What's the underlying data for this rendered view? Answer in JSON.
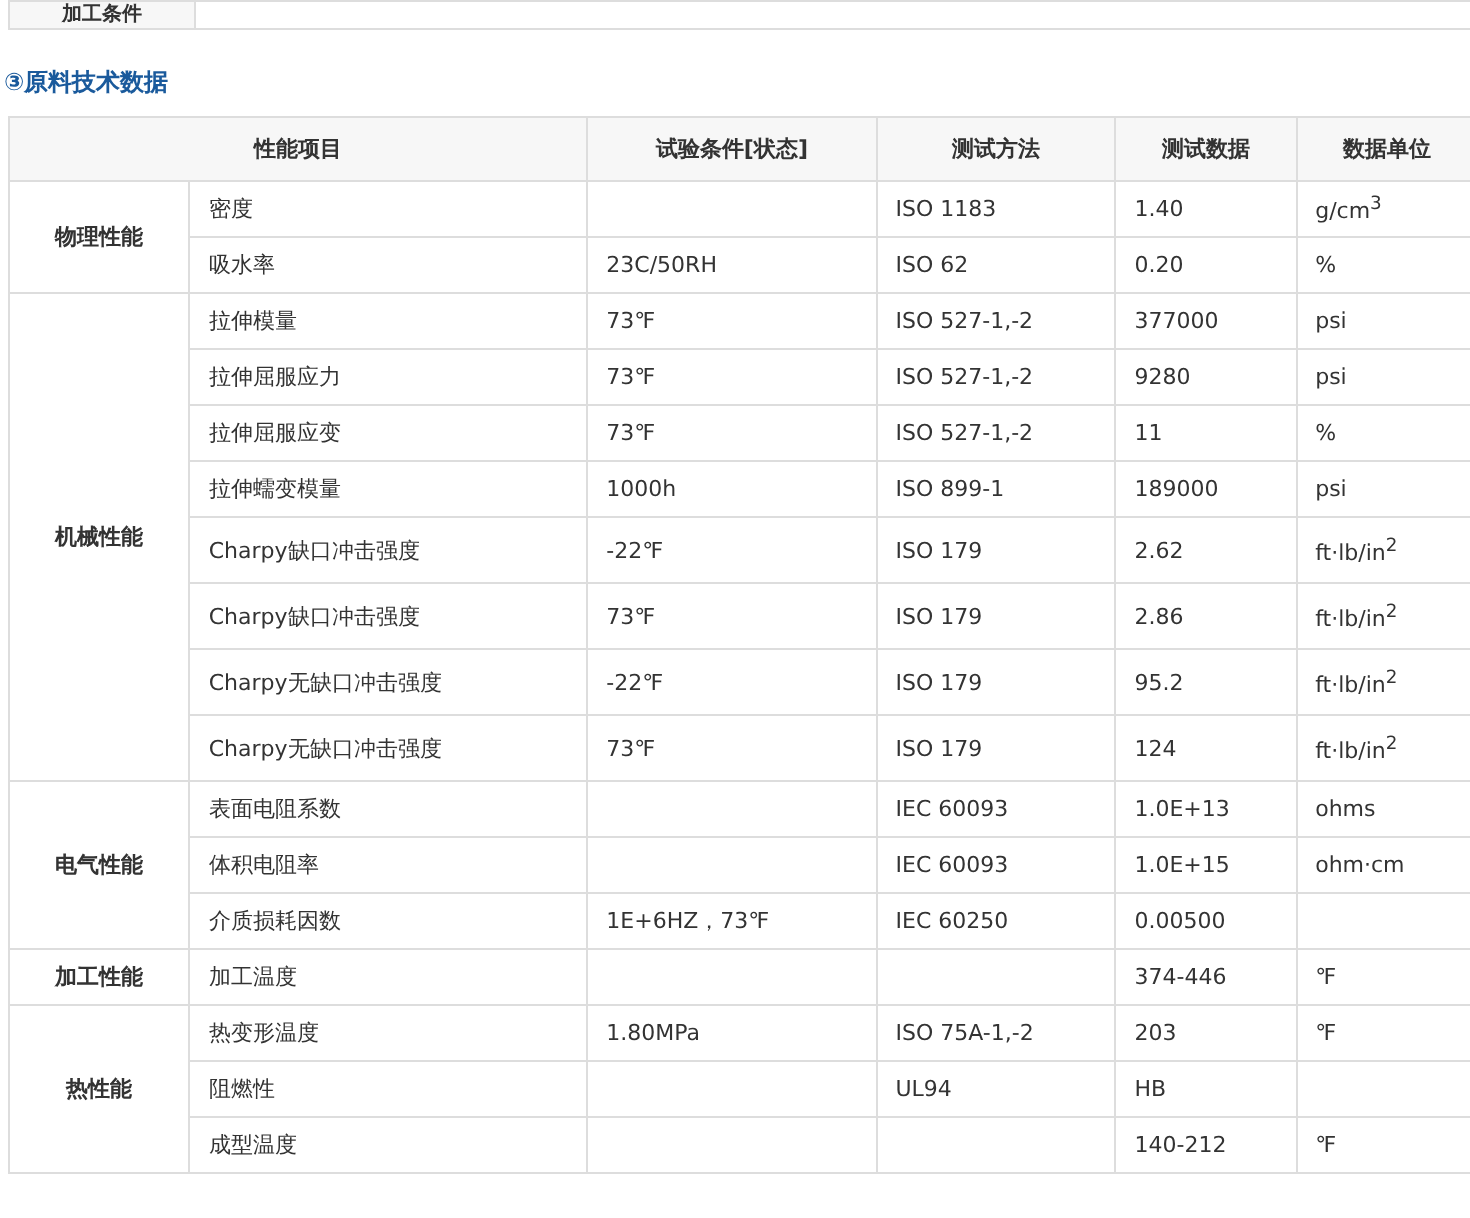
{
  "previous_table": {
    "label": "加工条件"
  },
  "section_title": "③原料技术数据",
  "table": {
    "columns": [
      "性能项目",
      "试验条件[状态]",
      "测试方法",
      "测试数据",
      "数据单位"
    ],
    "groups": [
      {
        "name": "物理性能",
        "rows": [
          {
            "item": "密度",
            "method": "ISO 1183",
            "value": "1.40",
            "unit": "g/cm$^{3}$"
          },
          {
            "item": "吸水率",
            "condition": "23C/50RH",
            "method": "ISO 62",
            "value": "0.20",
            "unit": "%"
          }
        ]
      },
      {
        "name": "机械性能",
        "rows": [
          {
            "item": "拉伸模量",
            "condition": "73℉",
            "method": "ISO 527-1,-2",
            "value": "377000",
            "unit": "psi"
          },
          {
            "item": "拉伸屈服应力",
            "condition": "73℉",
            "method": "ISO 527-1,-2",
            "value": "9280",
            "unit": "psi"
          },
          {
            "item": "拉伸屈服应变",
            "condition": "73℉",
            "method": "ISO 527-1,-2",
            "value": "11",
            "unit": "%"
          },
          {
            "item": "拉伸蠕变模量",
            "condition": "1000h",
            "method": "ISO 899-1",
            "value": "189000",
            "unit": "psi"
          },
          {
            "item": "Charpy缺口冲击强度",
            "condition": "-22℉",
            "method": "ISO 179",
            "value": "2.62",
            "unit": "ft·lb/in$^{2}$"
          },
          {
            "item": "Charpy缺口冲击强度",
            "condition": "73℉",
            "method": "ISO 179",
            "value": "2.86",
            "unit": "ft·lb/in$^{2}$"
          },
          {
            "item": "Charpy无缺口冲击强度",
            "condition": "-22℉",
            "method": "ISO 179",
            "value": "95.2",
            "unit": "ft·lb/in$^{2}$"
          },
          {
            "item": "Charpy无缺口冲击强度",
            "condition": "73℉",
            "method": "ISO 179",
            "value": "124",
            "unit": "ft·lb/in$^{2}$"
          }
        ]
      },
      {
        "name": "电气性能",
        "rows": [
          {
            "item": "表面电阻系数",
            "method": "IEC 60093",
            "value": "1.0E+13",
            "unit": "ohms"
          },
          {
            "item": "体积电阻率",
            "method": "IEC 60093",
            "value": "1.0E+15",
            "unit": "ohm·cm"
          },
          {
            "item": "介质损耗因数",
            "condition": "1E+6HZ，73℉",
            "method": "IEC 60250",
            "value": "0.00500"
          }
        ]
      },
      {
        "name": "加工性能",
        "rows": [
          {
            "item": "加工温度",
            "value": "374-446",
            "unit": "℉"
          }
        ]
      },
      {
        "name": "热性能",
        "rows": [
          {
            "item": "热变形温度",
            "condition": "1.80MPa",
            "method": "ISO 75A-1,-2",
            "value": "203",
            "unit": "℉"
          },
          {
            "item": "阻燃性",
            "method": "UL94",
            "value": "HB"
          },
          {
            "item": "成型温度",
            "value": "140-212",
            "unit": "℉"
          }
        ]
      }
    ]
  }
}
